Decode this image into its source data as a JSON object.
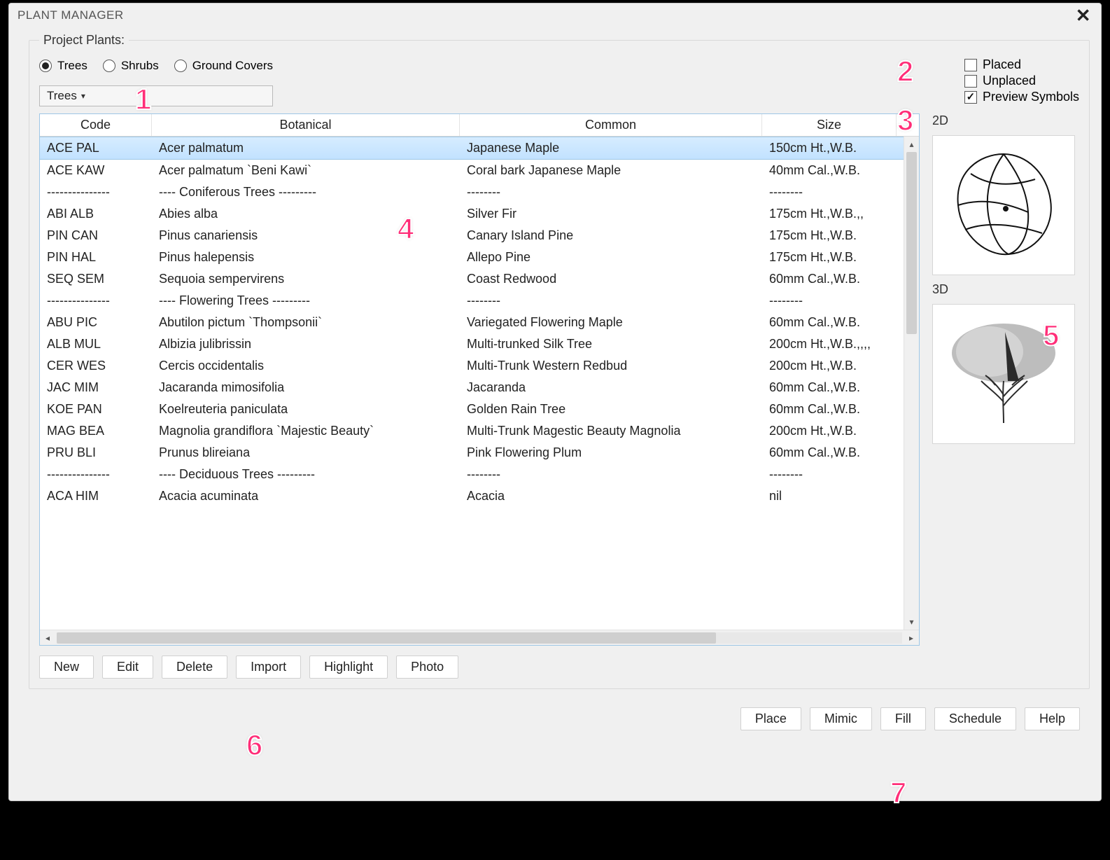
{
  "window": {
    "title": "PLANT MANAGER"
  },
  "fieldset_legend": "Project Plants:",
  "radios": {
    "trees_label": "Trees",
    "shrubs_label": "Shrubs",
    "groundcovers_label": "Ground Covers",
    "selected": "trees"
  },
  "combo": {
    "value": "Trees"
  },
  "checkboxes": {
    "placed_label": "Placed",
    "unplaced_label": "Unplaced",
    "preview_label": "Preview Symbols",
    "placed_checked": false,
    "unplaced_checked": false,
    "preview_checked": true
  },
  "table": {
    "columns": {
      "code": "Code",
      "botanical": "Botanical",
      "common": "Common",
      "size": "Size"
    },
    "rows": [
      {
        "code": "ACE PAL",
        "botanical": "Acer palmatum",
        "common": "Japanese Maple",
        "size": "150cm Ht.,W.B.",
        "selected": true
      },
      {
        "code": "ACE KAW",
        "botanical": "Acer palmatum `Beni Kawi`",
        "common": "Coral bark Japanese Maple",
        "size": "40mm Cal.,W.B."
      },
      {
        "code": "---------------",
        "botanical": "---- Coniferous Trees ---------",
        "common": "--------",
        "size": "--------"
      },
      {
        "code": "ABI ALB",
        "botanical": "Abies alba",
        "common": "Silver Fir",
        "size": "175cm Ht.,W.B.,,"
      },
      {
        "code": "PIN CAN",
        "botanical": "Pinus canariensis",
        "common": "Canary Island Pine",
        "size": "175cm Ht.,W.B."
      },
      {
        "code": "PIN HAL",
        "botanical": "Pinus halepensis",
        "common": "Allepo Pine",
        "size": "175cm Ht.,W.B."
      },
      {
        "code": "SEQ SEM",
        "botanical": "Sequoia sempervirens",
        "common": "Coast Redwood",
        "size": "60mm Cal.,W.B."
      },
      {
        "code": "---------------",
        "botanical": "---- Flowering Trees ---------",
        "common": "--------",
        "size": "--------"
      },
      {
        "code": "ABU PIC",
        "botanical": "Abutilon pictum `Thompsonii`",
        "common": "Variegated Flowering Maple",
        "size": "60mm Cal.,W.B."
      },
      {
        "code": "ALB MUL",
        "botanical": "Albizia julibrissin",
        "common": "Multi-trunked Silk Tree",
        "size": "200cm Ht.,W.B.,,,,"
      },
      {
        "code": "CER WES",
        "botanical": "Cercis occidentalis",
        "common": "Multi-Trunk Western Redbud",
        "size": "200cm Ht.,W.B."
      },
      {
        "code": "JAC MIM",
        "botanical": "Jacaranda mimosifolia",
        "common": "Jacaranda",
        "size": "60mm Cal.,W.B."
      },
      {
        "code": "KOE PAN",
        "botanical": "Koelreuteria paniculata",
        "common": "Golden Rain Tree",
        "size": "60mm Cal.,W.B."
      },
      {
        "code": "MAG BEA",
        "botanical": "Magnolia grandiflora `Majestic Beauty`",
        "common": "Multi-Trunk Magestic Beauty Magnolia",
        "size": "200cm Ht.,W.B."
      },
      {
        "code": "PRU BLI",
        "botanical": "Prunus blireiana",
        "common": "Pink Flowering Plum",
        "size": "60mm Cal.,W.B."
      },
      {
        "code": "---------------",
        "botanical": "---- Deciduous Trees ---------",
        "common": "--------",
        "size": "--------"
      },
      {
        "code": "ACA HIM",
        "botanical": "Acacia acuminata",
        "common": "Acacia",
        "size": "nil"
      }
    ]
  },
  "previews": {
    "label2d": "2D",
    "label3d": "3D"
  },
  "toolbar": {
    "new": "New",
    "edit": "Edit",
    "delete": "Delete",
    "import": "Import",
    "highlight": "Highlight",
    "photo": "Photo"
  },
  "footer": {
    "place": "Place",
    "mimic": "Mimic",
    "fill": "Fill",
    "schedule": "Schedule",
    "help": "Help"
  },
  "callouts": {
    "c1": "1",
    "c2": "2",
    "c3": "3",
    "c4": "4",
    "c5": "5",
    "c6": "6",
    "c7": "7"
  }
}
